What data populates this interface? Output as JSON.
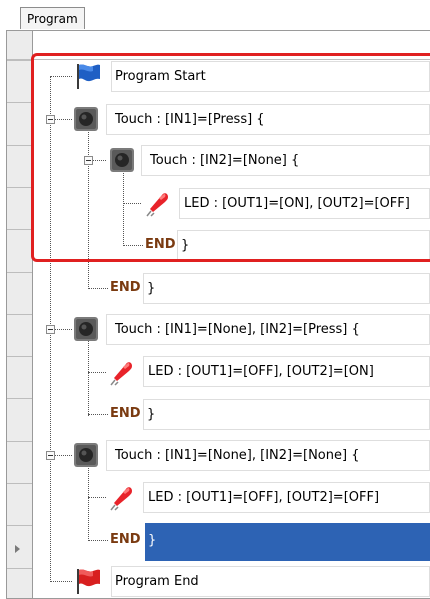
{
  "tab": {
    "label": "Program"
  },
  "rows": {
    "program_start": "Program Start",
    "touch1": "Touch : [IN1]=[Press] {",
    "touch2": "Touch : [IN2]=[None] {",
    "led1": "LED : [OUT1]=[ON], [OUT2]=[OFF]",
    "touch3": "Touch : [IN1]=[None], [IN2]=[Press] {",
    "led2": "LED : [OUT1]=[OFF], [OUT2]=[ON]",
    "touch4": "Touch : [IN1]=[None], [IN2]=[None] {",
    "led3": "LED : [OUT1]=[OFF], [OUT2]=[OFF]",
    "program_end": "Program End"
  },
  "end_keyword": "END",
  "close_brace": "}",
  "colors": {
    "selection": "#2d63b4",
    "highlight_border": "#e02020",
    "end_keyword": "#7a3a10"
  },
  "icons": [
    "flag-blue-icon",
    "touch-button-icon",
    "led-icon",
    "flag-red-icon"
  ]
}
